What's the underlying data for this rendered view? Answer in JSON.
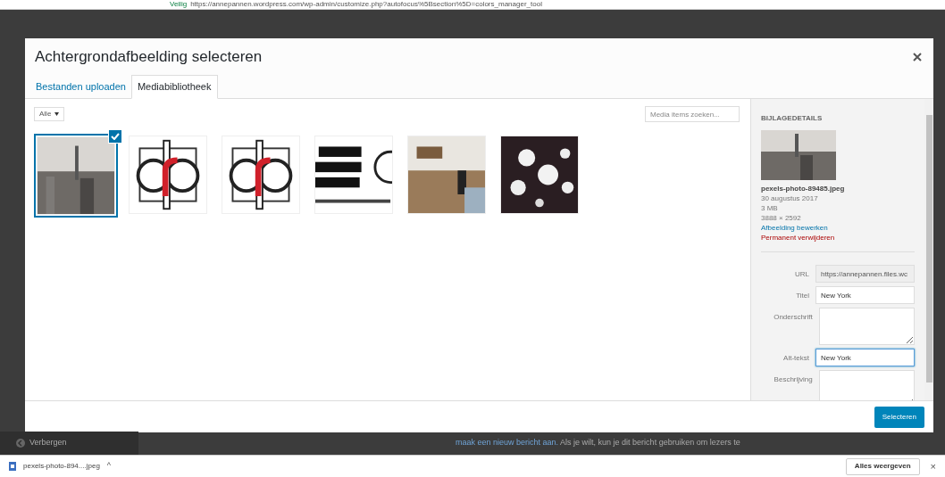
{
  "browser": {
    "security": "Veilig",
    "url": "https://annepannen.wordpress.com/wp-admin/customize.php?autofocus%5Bsection%5D=colors_manager_tool"
  },
  "background": {
    "hide_label": "Verbergen",
    "link": "maak een nieuw bericht aan.",
    "text": "Als je wilt, kun je dit bericht gebruiken om lezers te"
  },
  "modal": {
    "title": "Achtergrondafbeelding selecteren",
    "tabs": [
      {
        "label": "Bestanden uploaden",
        "selected": false
      },
      {
        "label": "Mediabibliotheek",
        "selected": true
      }
    ],
    "filter": "Alle",
    "search_placeholder": "Media items zoeken...",
    "items": [
      {
        "kind": "city",
        "selected": true
      },
      {
        "kind": "logo",
        "selected": false
      },
      {
        "kind": "logo",
        "selected": false
      },
      {
        "kind": "wordmark",
        "selected": false
      },
      {
        "kind": "table",
        "selected": false
      },
      {
        "kind": "lights",
        "selected": false
      }
    ],
    "details": {
      "heading": "BIJLAGEDETAILS",
      "filename": "pexels-photo-89485.jpeg",
      "date": "30 augustus 2017",
      "size": "3 MB",
      "dimensions": "3888 × 2592",
      "edit_link": "Afbeelding bewerken",
      "delete_link": "Permanent verwijderen",
      "fields": [
        {
          "label": "URL",
          "value": "https://annepannen.files.wc",
          "kind": "input",
          "readonly": true,
          "focused": false
        },
        {
          "label": "Titel",
          "value": "New York",
          "kind": "input",
          "readonly": false,
          "focused": false
        },
        {
          "label": "Onderschrift",
          "kind": "textarea",
          "readonly": false,
          "focused": false
        },
        {
          "label": "Alt-tekst",
          "value": "New York",
          "kind": "input",
          "readonly": false,
          "focused": true
        },
        {
          "label": "Beschrijving",
          "kind": "textarea",
          "readonly": false,
          "focused": false
        }
      ]
    },
    "button": "Selecteren"
  },
  "download_bar": {
    "file": "pexels-photo-894....jpeg",
    "caret": "^",
    "show_all": "Alles weergeven",
    "close": "×"
  }
}
